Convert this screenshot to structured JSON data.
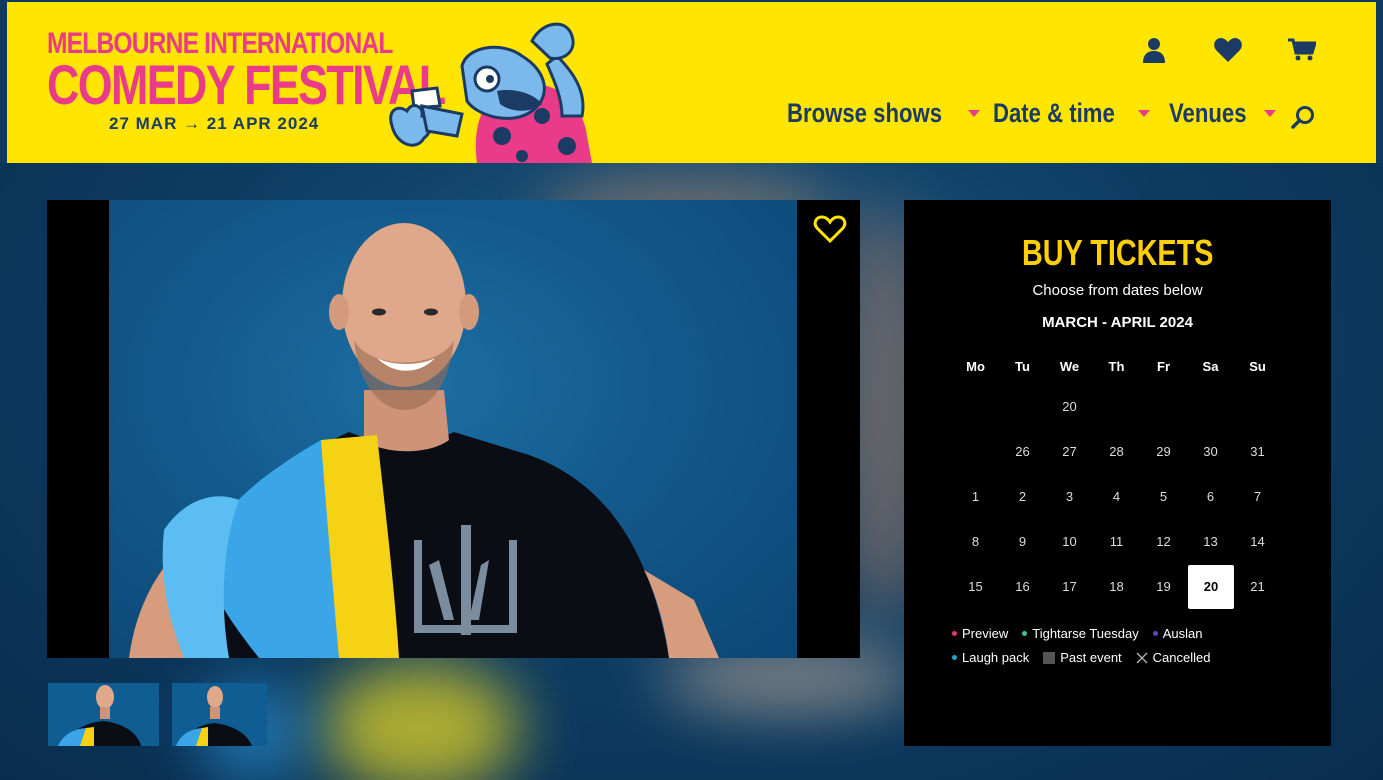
{
  "header": {
    "logo_line1": "MELBOURNE INTERNATIONAL",
    "logo_line2": "COMEDY FESTIVAL",
    "logo_dates": "27 MAR → 21 APR 2024",
    "icons": [
      "account-icon",
      "heart-icon",
      "cart-icon"
    ],
    "nav": [
      {
        "label": "Browse shows"
      },
      {
        "label": "Date & time"
      },
      {
        "label": "Venues"
      }
    ],
    "colors": {
      "background": "#ffe500",
      "brand_pink": "#ea3a8a",
      "nav_text": "#1b3a64"
    }
  },
  "tickets": {
    "title": "BUY TICKETS",
    "subtitle": "Choose from dates below",
    "month": "MARCH - APRIL 2024",
    "weekdays": [
      "Mo",
      "Tu",
      "We",
      "Th",
      "Fr",
      "Sa",
      "Su"
    ],
    "rows": [
      [
        "",
        "",
        "20",
        "",
        "",
        "",
        ""
      ],
      [
        "",
        "26",
        "27",
        "28",
        "29",
        "30",
        "31"
      ],
      [
        "1",
        "2",
        "3",
        "4",
        "5",
        "6",
        "7"
      ],
      [
        "8",
        "9",
        "10",
        "11",
        "12",
        "13",
        "14"
      ],
      [
        "15",
        "16",
        "17",
        "18",
        "19",
        "20",
        "21"
      ]
    ],
    "selected": "20",
    "legend": {
      "preview": "Preview",
      "tightarse": "Tightarse Tuesday",
      "auslan": "Auslan",
      "laugh_pack": "Laugh pack",
      "past_event": "Past event",
      "cancelled": "Cancelled"
    },
    "colors": {
      "title": "#ffcf06",
      "preview": "#e8307f",
      "tightarse": "#37c98a",
      "auslan": "#5a4bb5",
      "laugh_pack": "#1ea6d6",
      "past_event": "#555555"
    }
  }
}
